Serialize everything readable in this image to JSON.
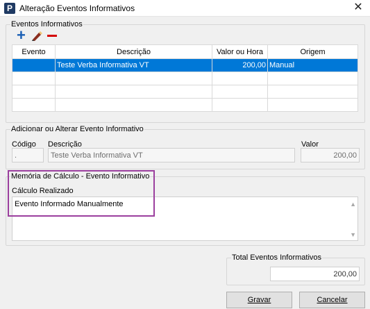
{
  "window": {
    "title": "Alteração Eventos Informativos",
    "app_icon": "P",
    "close_icon": "✕"
  },
  "eventos": {
    "legend": "Eventos Informativos",
    "toolbar": {
      "add_icon": "plus-icon",
      "edit_icon": "pencil-icon",
      "remove_icon": "minus-icon"
    },
    "columns": [
      "Evento",
      "Descrição",
      "Valor ou Hora",
      "Origem"
    ],
    "rows": [
      {
        "evento": "",
        "descricao": "Teste Verba Informativa VT",
        "valor": "200,00",
        "origem": "Manual"
      }
    ]
  },
  "form": {
    "legend": "Adicionar ou Alterar Evento Informativo",
    "codigo_label": "Código",
    "codigo_value": ".",
    "descricao_label": "Descrição",
    "descricao_value": "Teste Verba Informativa VT",
    "valor_label": "Valor",
    "valor_value": "200,00"
  },
  "memoria": {
    "legend": "Memória de Cálculo - Evento Informativo",
    "calc_label": "Cálculo Realizado",
    "calc_text": "Evento Informado Manualmente"
  },
  "total": {
    "legend": "Total Eventos Informativos",
    "value": "200,00"
  },
  "buttons": {
    "save": "Gravar",
    "cancel": "Cancelar"
  },
  "colors": {
    "selection": "#0078d7",
    "highlight_border": "#9b3f9e",
    "add": "#1a5fb4",
    "remove": "#d40000"
  }
}
